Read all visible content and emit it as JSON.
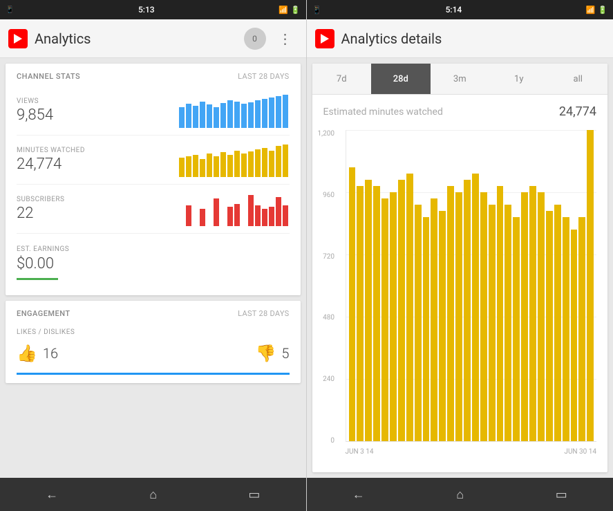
{
  "left": {
    "statusBar": {
      "time": "5:13",
      "icons": [
        "signal",
        "wifi",
        "battery"
      ]
    },
    "appBar": {
      "title": "Analytics",
      "notificationCount": "0",
      "moreLabel": "⋮"
    },
    "channelStats": {
      "sectionLabel": "CHANNEL STATS",
      "period": "LAST 28 DAYS",
      "views": {
        "label": "VIEWS",
        "value": "9,854"
      },
      "minutesWatched": {
        "label": "MINUTES WATCHED",
        "value": "24,774"
      },
      "subscribers": {
        "label": "SUBSCRIBERS",
        "value": "22"
      },
      "estEarnings": {
        "label": "EST. EARNINGS",
        "value": "$0.00"
      }
    },
    "engagement": {
      "sectionLabel": "ENGAGEMENT",
      "period": "LAST 28 DAYS",
      "likesDislikes": {
        "label": "LIKES / DISLIKES",
        "likes": "16",
        "dislikes": "5"
      }
    },
    "nav": {
      "back": "←",
      "home": "⌂",
      "recents": "▭"
    }
  },
  "right": {
    "statusBar": {
      "time": "5:14",
      "icons": [
        "signal",
        "wifi",
        "battery"
      ]
    },
    "appBar": {
      "title": "Analytics details"
    },
    "tabs": [
      {
        "label": "7d",
        "active": false
      },
      {
        "label": "28d",
        "active": true
      },
      {
        "label": "3m",
        "active": false
      },
      {
        "label": "1y",
        "active": false
      },
      {
        "label": "all",
        "active": false
      }
    ],
    "chart": {
      "metricLabel": "Estimated minutes watched",
      "metricValue": "24,774",
      "yLabels": [
        "1,200",
        "960",
        "720",
        "480",
        "240",
        "0"
      ],
      "xLabels": [
        "JUN 3 14",
        "JUN 30 14"
      ],
      "bars": [
        88,
        82,
        84,
        82,
        78,
        80,
        84,
        86,
        76,
        72,
        78,
        74,
        82,
        80,
        84,
        86,
        80,
        76,
        82,
        76,
        72,
        80,
        82,
        80,
        74,
        76,
        72,
        68,
        72,
        100
      ]
    },
    "nav": {
      "back": "←",
      "home": "⌂",
      "recents": "▭"
    }
  }
}
